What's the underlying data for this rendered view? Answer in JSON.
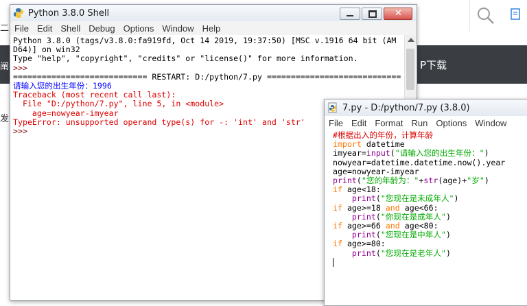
{
  "background": {
    "band_text": "P下载",
    "left_chars": [
      "二",
      "阐",
      "发"
    ]
  },
  "shell": {
    "title": "Python 3.8.0 Shell",
    "menu": [
      "File",
      "Edit",
      "Shell",
      "Debug",
      "Options",
      "Window",
      "Help"
    ],
    "lines": [
      {
        "text": "Python 3.8.0 (tags/v3.8.0:fa919fd, Oct 14 2019, 19:37:50) [MSC v.1916 64 bit (AM",
        "color": "black"
      },
      {
        "text": "D64)] on win32",
        "color": "black"
      },
      {
        "text": "Type \"help\", \"copyright\", \"credits\" or \"license()\" for more information.",
        "color": "black"
      },
      {
        "text": ">>> ",
        "color": "purple"
      },
      {
        "text": "============================ RESTART: D:/python/7.py ============================",
        "color": "black"
      },
      {
        "text": "请输入您的出生年份：1996",
        "color": "blue"
      },
      {
        "text": "Traceback (most recent call last):",
        "color": "red"
      },
      {
        "text": "  File \"D:/python/7.py\", line 5, in <module>",
        "color": "red"
      },
      {
        "text": "    age=nowyear-imyear",
        "color": "red"
      },
      {
        "text": "TypeError: unsupported operand type(s) for -: 'int' and 'str'",
        "color": "red"
      },
      {
        "text": ">>> ",
        "color": "purple"
      }
    ]
  },
  "editor": {
    "title": "7.py - D:/python/7.py (3.8.0)",
    "menu": [
      "File",
      "Edit",
      "Format",
      "Run",
      "Options",
      "Window"
    ],
    "code": [
      [
        {
          "t": "#根据出入的年份，计算年龄",
          "c": "cm"
        }
      ],
      [
        {
          "t": "import",
          "c": "kw"
        },
        {
          "t": " datetime",
          "c": "nm"
        }
      ],
      [
        {
          "t": "imyear=",
          "c": "nm"
        },
        {
          "t": "input",
          "c": "bi"
        },
        {
          "t": "(",
          "c": "nm"
        },
        {
          "t": "\"请输入您的出生年份：\"",
          "c": "st"
        },
        {
          "t": ")",
          "c": "nm"
        }
      ],
      [
        {
          "t": "nowyear=datetime.datetime.now().year",
          "c": "nm"
        }
      ],
      [
        {
          "t": "age=nowyear-imyear",
          "c": "nm"
        }
      ],
      [
        {
          "t": "print",
          "c": "bi"
        },
        {
          "t": "(",
          "c": "nm"
        },
        {
          "t": "\"您的年龄为：\"",
          "c": "st"
        },
        {
          "t": "+",
          "c": "nm"
        },
        {
          "t": "str",
          "c": "bi"
        },
        {
          "t": "(age)+",
          "c": "nm"
        },
        {
          "t": "\"岁\"",
          "c": "st"
        },
        {
          "t": ")",
          "c": "nm"
        }
      ],
      [
        {
          "t": "if",
          "c": "kw"
        },
        {
          "t": " age<18:",
          "c": "nm"
        }
      ],
      [
        {
          "t": "    ",
          "c": "nm"
        },
        {
          "t": "print",
          "c": "bi"
        },
        {
          "t": "(",
          "c": "nm"
        },
        {
          "t": "\"您现在是未成年人\"",
          "c": "st"
        },
        {
          "t": ")",
          "c": "nm"
        }
      ],
      [
        {
          "t": "if",
          "c": "kw"
        },
        {
          "t": " age>=18 ",
          "c": "nm"
        },
        {
          "t": "and",
          "c": "kw"
        },
        {
          "t": " age<66:",
          "c": "nm"
        }
      ],
      [
        {
          "t": "    ",
          "c": "nm"
        },
        {
          "t": "print",
          "c": "bi"
        },
        {
          "t": "(",
          "c": "nm"
        },
        {
          "t": "\"你现在是成年人\"",
          "c": "st"
        },
        {
          "t": ")",
          "c": "nm"
        }
      ],
      [
        {
          "t": "if",
          "c": "kw"
        },
        {
          "t": " age>=66 ",
          "c": "nm"
        },
        {
          "t": "and",
          "c": "kw"
        },
        {
          "t": " age<80:",
          "c": "nm"
        }
      ],
      [
        {
          "t": "    ",
          "c": "nm"
        },
        {
          "t": "print",
          "c": "bi"
        },
        {
          "t": "(",
          "c": "nm"
        },
        {
          "t": "\"您现在是中年人\"",
          "c": "st"
        },
        {
          "t": ")",
          "c": "nm"
        }
      ],
      [
        {
          "t": "if",
          "c": "kw"
        },
        {
          "t": " age>=80:",
          "c": "nm"
        }
      ],
      [
        {
          "t": "    ",
          "c": "nm"
        },
        {
          "t": "print",
          "c": "bi"
        },
        {
          "t": "(",
          "c": "nm"
        },
        {
          "t": "\"您现在是老年人\"",
          "c": "st"
        },
        {
          "t": ")",
          "c": "nm"
        }
      ]
    ]
  },
  "colors": {
    "shell_black": "#000000",
    "shell_blue": "#0000ff",
    "shell_red": "#dd0000",
    "prompt": "#7f0000",
    "keyword": "#ff7700",
    "builtin": "#900090",
    "string": "#00aa00",
    "comment": "#dd0000"
  }
}
